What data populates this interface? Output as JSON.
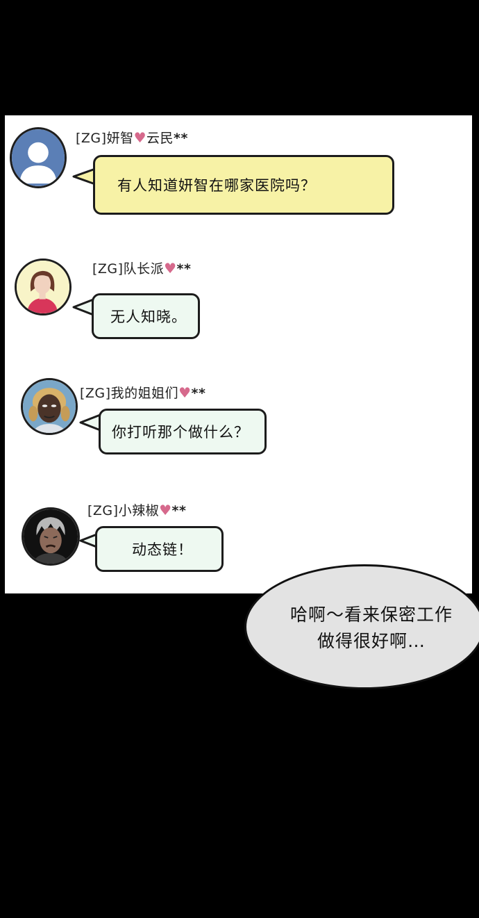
{
  "messages": [
    {
      "name": "[ZG]妍智",
      "suffix": "云民",
      "stars": "**",
      "heart": "♥",
      "text": "有人知道妍智在哪家医院吗？",
      "avatar": "default-user-icon"
    },
    {
      "name": "[ZG]队长派",
      "suffix": "",
      "stars": "**",
      "heart": "♥",
      "text": "无人知晓。",
      "avatar": "woman-avatar"
    },
    {
      "name": "[ZG]我的姐姐们",
      "suffix": "",
      "stars": "**",
      "heart": "♥",
      "text": "你打听那个做什么？",
      "avatar": "braided-woman-avatar"
    },
    {
      "name": "[ZG]小辣椒",
      "suffix": "",
      "stars": "**",
      "heart": "♥",
      "text": "动态链！",
      "avatar": "grey-haired-man-avatar"
    }
  ],
  "speech": {
    "line1": "哈啊～看来保密工作",
    "line2": "做得很好啊…"
  },
  "colors": {
    "heart": "#d6698c",
    "yellow_bubble": "#f7f2a6",
    "mint_bubble": "#eef9f1",
    "speech_bubble": "#e3e3e3"
  }
}
